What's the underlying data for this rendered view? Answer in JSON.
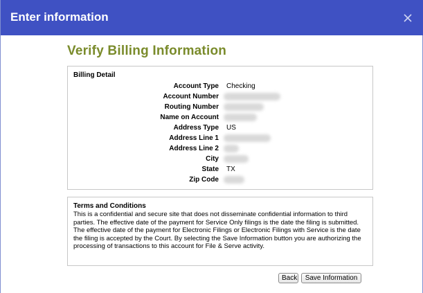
{
  "dialog": {
    "title": "Enter information",
    "heading": "Verify Billing Information"
  },
  "billing": {
    "section_title": "Billing Detail",
    "rows": [
      {
        "label": "Account Type",
        "value": "Checking"
      },
      {
        "label": "Account Number",
        "value": ""
      },
      {
        "label": "Routing Number",
        "value": ""
      },
      {
        "label": "Name on Account",
        "value": ""
      },
      {
        "label": "Address Type",
        "value": "US"
      },
      {
        "label": "Address Line 1",
        "value": ""
      },
      {
        "label": "Address Line 2",
        "value": ""
      },
      {
        "label": "City",
        "value": ""
      },
      {
        "label": "State",
        "value": "TX"
      },
      {
        "label": "Zip Code",
        "value": ""
      }
    ]
  },
  "terms": {
    "section_title": "Terms and Conditions",
    "text": "This is a confidential and secure site that does not disseminate confidential information to third parties. The effective date of the payment for Service Only filings is the date the filing is submitted. The effective date of the payment for Electronic Filings or Electronic Filings with Service is the date the filing is accepted by the Court. By selecting the Save Information button you are authorizing the processing of transactions to this account for File & Serve activity."
  },
  "buttons": {
    "back": "Back",
    "save": "Save Information"
  },
  "icons": {
    "close": "close-icon"
  },
  "colors": {
    "titlebar": "#3f51c3",
    "heading": "#7a8b2b"
  }
}
